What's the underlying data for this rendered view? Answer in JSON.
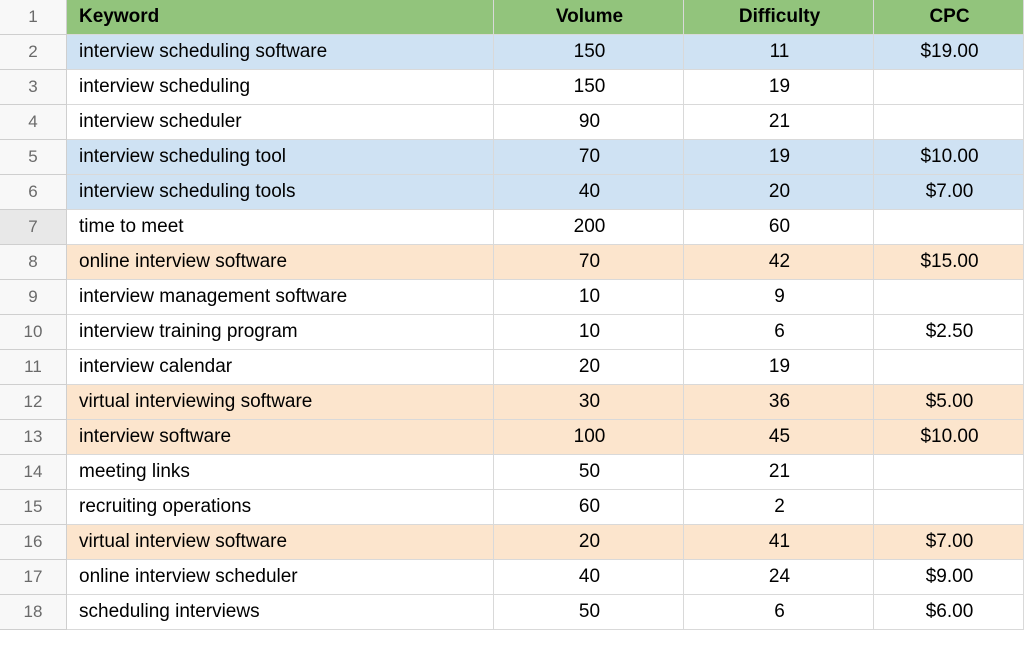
{
  "chart_data": {
    "type": "table",
    "columns": [
      "Keyword",
      "Volume",
      "Difficulty",
      "CPC"
    ],
    "rows": [
      [
        "interview scheduling software",
        150,
        11,
        "$19.00"
      ],
      [
        "interview scheduling",
        150,
        19,
        ""
      ],
      [
        "interview scheduler",
        90,
        21,
        ""
      ],
      [
        "interview scheduling tool",
        70,
        19,
        "$10.00"
      ],
      [
        "interview scheduling tools",
        40,
        20,
        "$7.00"
      ],
      [
        "time to meet",
        200,
        60,
        ""
      ],
      [
        "online interview software",
        70,
        42,
        "$15.00"
      ],
      [
        "interview management software",
        10,
        9,
        ""
      ],
      [
        "interview training program",
        10,
        6,
        "$2.50"
      ],
      [
        "interview calendar",
        20,
        19,
        ""
      ],
      [
        "virtual interviewing software",
        30,
        36,
        "$5.00"
      ],
      [
        "interview software",
        100,
        45,
        "$10.00"
      ],
      [
        "meeting links",
        50,
        21,
        ""
      ],
      [
        "recruiting operations",
        60,
        2,
        ""
      ],
      [
        "virtual interview software",
        20,
        41,
        "$7.00"
      ],
      [
        "online interview scheduler",
        40,
        24,
        "$9.00"
      ],
      [
        "scheduling interviews",
        50,
        6,
        "$6.00"
      ]
    ]
  },
  "headers": {
    "keyword": "Keyword",
    "volume": "Volume",
    "difficulty": "Difficulty",
    "cpc": "CPC"
  },
  "rownums": [
    "1",
    "2",
    "3",
    "4",
    "5",
    "6",
    "7",
    "8",
    "9",
    "10",
    "11",
    "12",
    "13",
    "14",
    "15",
    "16",
    "17",
    "18"
  ],
  "rows": [
    {
      "n": "2",
      "cls": "blue",
      "keyword": "interview scheduling software",
      "volume": "150",
      "difficulty": "11",
      "cpc": "$19.00"
    },
    {
      "n": "3",
      "cls": "",
      "keyword": "interview scheduling",
      "volume": "150",
      "difficulty": "19",
      "cpc": ""
    },
    {
      "n": "4",
      "cls": "",
      "keyword": "interview scheduler",
      "volume": "90",
      "difficulty": "21",
      "cpc": ""
    },
    {
      "n": "5",
      "cls": "blue",
      "keyword": "interview scheduling tool",
      "volume": "70",
      "difficulty": "19",
      "cpc": "$10.00"
    },
    {
      "n": "6",
      "cls": "blue",
      "keyword": "interview scheduling tools",
      "volume": "40",
      "difficulty": "20",
      "cpc": "$7.00"
    },
    {
      "n": "7",
      "cls": "",
      "keyword": "time to meet",
      "volume": "200",
      "difficulty": "60",
      "cpc": "",
      "sel": true
    },
    {
      "n": "8",
      "cls": "yellow",
      "keyword": "online interview software",
      "volume": "70",
      "difficulty": "42",
      "cpc": "$15.00"
    },
    {
      "n": "9",
      "cls": "",
      "keyword": "interview management software",
      "volume": "10",
      "difficulty": "9",
      "cpc": ""
    },
    {
      "n": "10",
      "cls": "",
      "keyword": "interview training program",
      "volume": "10",
      "difficulty": "6",
      "cpc": "$2.50"
    },
    {
      "n": "11",
      "cls": "",
      "keyword": "interview calendar",
      "volume": "20",
      "difficulty": "19",
      "cpc": ""
    },
    {
      "n": "12",
      "cls": "yellow",
      "keyword": "virtual interviewing software",
      "volume": "30",
      "difficulty": "36",
      "cpc": "$5.00"
    },
    {
      "n": "13",
      "cls": "yellow",
      "keyword": "interview software",
      "volume": "100",
      "difficulty": "45",
      "cpc": "$10.00"
    },
    {
      "n": "14",
      "cls": "",
      "keyword": "meeting links",
      "volume": "50",
      "difficulty": "21",
      "cpc": ""
    },
    {
      "n": "15",
      "cls": "",
      "keyword": "recruiting operations",
      "volume": "60",
      "difficulty": "2",
      "cpc": ""
    },
    {
      "n": "16",
      "cls": "yellow",
      "keyword": "virtual interview software",
      "volume": "20",
      "difficulty": "41",
      "cpc": "$7.00"
    },
    {
      "n": "17",
      "cls": "",
      "keyword": "online interview scheduler",
      "volume": "40",
      "difficulty": "24",
      "cpc": "$9.00"
    },
    {
      "n": "18",
      "cls": "",
      "keyword": "scheduling interviews",
      "volume": "50",
      "difficulty": "6",
      "cpc": "$6.00"
    }
  ]
}
